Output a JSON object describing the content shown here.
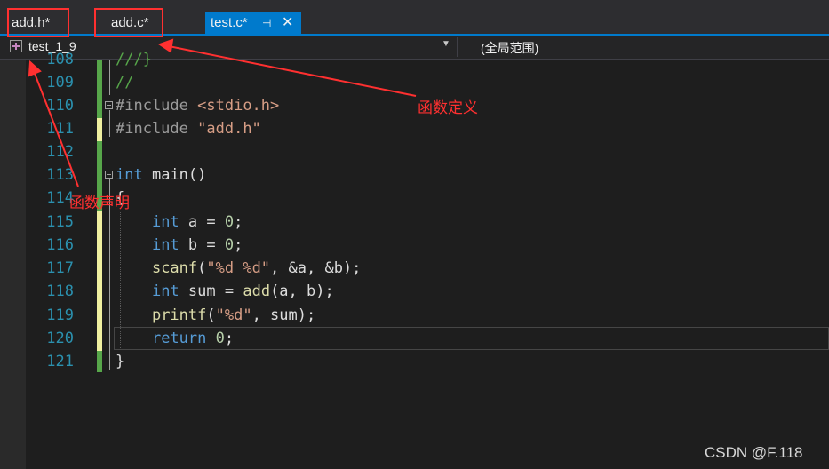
{
  "tabs": [
    {
      "label": "add.h*"
    },
    {
      "label": "add.c*"
    },
    {
      "label": "test.c*",
      "pin": "⊣",
      "close": "✕"
    }
  ],
  "nav": {
    "project": "test_1_9",
    "scope": "(全局范围)"
  },
  "line_numbers": [
    "108",
    "109",
    "110",
    "111",
    "112",
    "113",
    "114",
    "115",
    "116",
    "117",
    "118",
    "119",
    "120",
    "121"
  ],
  "code": {
    "l108": "///}",
    "l109": "//",
    "l110_kw": "#include",
    "l110_inc": "<stdio.h>",
    "l111_kw": "#include",
    "l111_inc": "\"add.h\"",
    "l113_type": "int",
    "l113_name": "main()",
    "l114": "{",
    "l115": {
      "kw": "int",
      "rest": "a = ",
      "num": "0",
      "end": ";"
    },
    "l116": {
      "kw": "int",
      "rest": "b = ",
      "num": "0",
      "end": ";"
    },
    "l117": {
      "fn": "scanf",
      "p1": "(",
      "str": "\"%d %d\"",
      "rest": ", &a, &b);"
    },
    "l118": {
      "kw": "int",
      "rest1": "sum = ",
      "fn": "add",
      "rest2": "(a, b);"
    },
    "l119": {
      "fn": "printf",
      "p1": "(",
      "str": "\"%d\"",
      "rest": ", sum);"
    },
    "l120": {
      "kw": "return",
      "num": "0",
      "end": ";"
    },
    "l121": "}"
  },
  "annotations": {
    "def": "函数定义",
    "decl": "函数声明"
  },
  "watermark": "CSDN @F.118",
  "colors": {
    "accent": "#007acc",
    "annotation": "#ff3030"
  }
}
